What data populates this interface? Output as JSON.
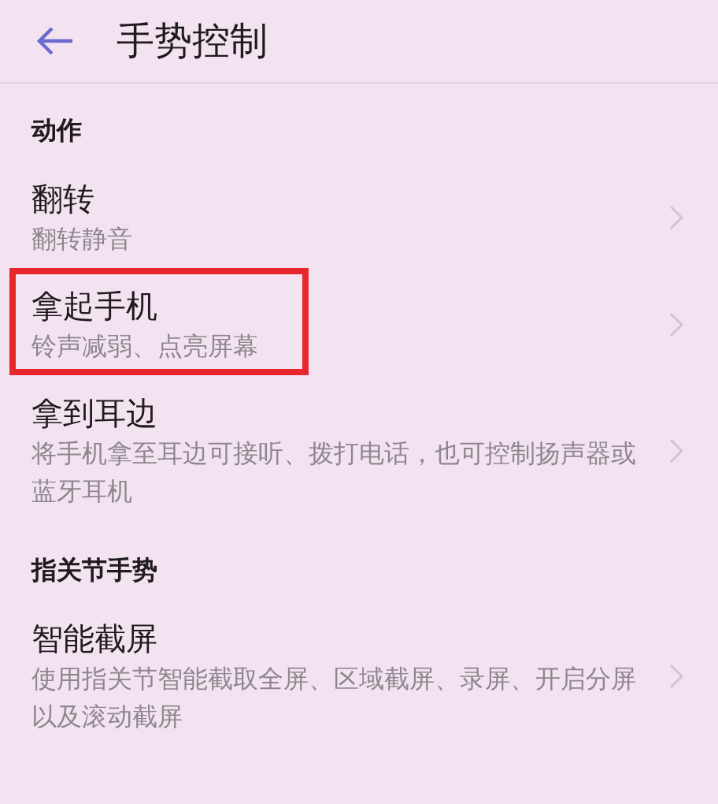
{
  "header": {
    "title": "手势控制"
  },
  "sections": [
    {
      "title": "动作",
      "items": [
        {
          "title": "翻转",
          "subtitle": "翻转静音",
          "highlighted": false
        },
        {
          "title": "拿起手机",
          "subtitle": "铃声减弱、点亮屏幕",
          "highlighted": true
        },
        {
          "title": "拿到耳边",
          "subtitle": "将手机拿至耳边可接听、拨打电话，也可控制扬声器或蓝牙耳机",
          "highlighted": false
        }
      ]
    },
    {
      "title": "指关节手势",
      "items": [
        {
          "title": "智能截屏",
          "subtitle": "使用指关节智能截取全屏、区域截屏、录屏、开启分屏以及滚动截屏",
          "highlighted": false
        }
      ]
    }
  ]
}
